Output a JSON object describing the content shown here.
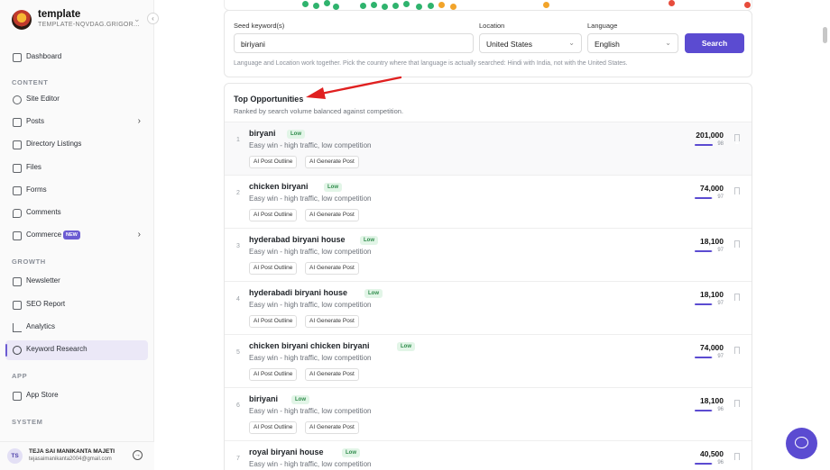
{
  "brand": {
    "name": "template",
    "sub": "TEMPLATE-NQVDAG.GRIGOR..."
  },
  "sidebar": {
    "dashboard": "Dashboard",
    "sections": {
      "content": "CONTENT",
      "growth": "GROWTH",
      "app": "APP",
      "system": "SYSTEM"
    },
    "content_items": [
      "Site Editor",
      "Posts",
      "Directory Listings",
      "Files",
      "Forms",
      "Comments",
      "Commerce"
    ],
    "commerce_badge": "NEW",
    "growth_items": [
      "Newsletter",
      "SEO Report",
      "Analytics",
      "Keyword Research"
    ],
    "app_items": [
      "App Store"
    ],
    "active": "Keyword Research"
  },
  "user": {
    "initials": "TS",
    "name": "TEJA SAI MANIKANTA MAJETI",
    "email": "tejasaimanikanta2004@gmail.com"
  },
  "search": {
    "seed_label": "Seed keyword(s)",
    "seed_value": "biriyani",
    "location_label": "Location",
    "location_value": "United States",
    "language_label": "Language",
    "language_value": "English",
    "button": "Search",
    "help": "Language and Location work together. Pick the country where that language is actually searched: Hindi with India, not with the United States."
  },
  "opportunities": {
    "title": "Top Opportunities",
    "subtitle": "Ranked by search volume balanced against competition.",
    "chip_outline": "AI Post Outline",
    "chip_generate": "AI Generate Post",
    "rows": [
      {
        "rank": "1",
        "keyword": "biryani",
        "difficulty": "Low",
        "desc": "Easy win - high traffic, low competition",
        "volume": "201,000",
        "score": "98"
      },
      {
        "rank": "2",
        "keyword": "chicken biryani",
        "difficulty": "Low",
        "desc": "Easy win - high traffic, low competition",
        "volume": "74,000",
        "score": "97"
      },
      {
        "rank": "3",
        "keyword": "hyderabad biryani house",
        "difficulty": "Low",
        "desc": "Easy win - high traffic, low competition",
        "volume": "18,100",
        "score": "97"
      },
      {
        "rank": "4",
        "keyword": "hyderabadi biryani house",
        "difficulty": "Low",
        "desc": "Easy win - high traffic, low competition",
        "volume": "18,100",
        "score": "97"
      },
      {
        "rank": "5",
        "keyword": "chicken biryani chicken biryani",
        "difficulty": "Low",
        "desc": "Easy win - high traffic, low competition",
        "volume": "74,000",
        "score": "97"
      },
      {
        "rank": "6",
        "keyword": "biriyani",
        "difficulty": "Low",
        "desc": "Easy win - high traffic, low competition",
        "volume": "18,100",
        "score": "96"
      },
      {
        "rank": "7",
        "keyword": "royal biryani house",
        "difficulty": "Low",
        "desc": "Easy win - high traffic, low competition",
        "volume": "40,500",
        "score": "96"
      }
    ]
  },
  "colors": {
    "accent": "#5b4bd1",
    "low_badge_bg": "#e2f5e7",
    "low_badge_text": "#2e8b4a",
    "arrow": "#e02020"
  },
  "icons": {
    "chat": "chat-bubble-icon",
    "bookmark": "bookmark-icon"
  }
}
